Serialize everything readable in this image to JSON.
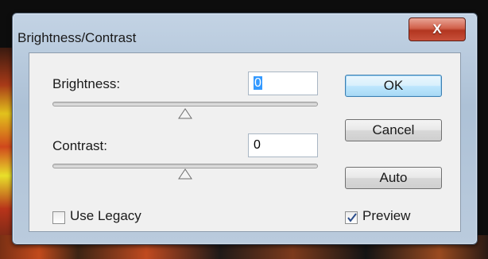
{
  "dialog": {
    "title": "Brightness/Contrast",
    "close_label": "X"
  },
  "brightness": {
    "label": "Brightness:",
    "value": "0",
    "slider_fraction": 0.5
  },
  "contrast": {
    "label": "Contrast:",
    "value": "0",
    "slider_fraction": 0.5
  },
  "buttons": {
    "ok": "OK",
    "cancel": "Cancel",
    "auto": "Auto"
  },
  "options": {
    "use_legacy": {
      "label": "Use Legacy",
      "checked": false
    },
    "preview": {
      "label": "Preview",
      "checked": true
    }
  },
  "colors": {
    "titlebar": "#bacbdd",
    "close_button": "#c8503a",
    "default_button": "#bee6fd"
  },
  "icons": {
    "slider_thumb": "triangle-thumb-icon",
    "checkmark": "checkmark-icon"
  }
}
